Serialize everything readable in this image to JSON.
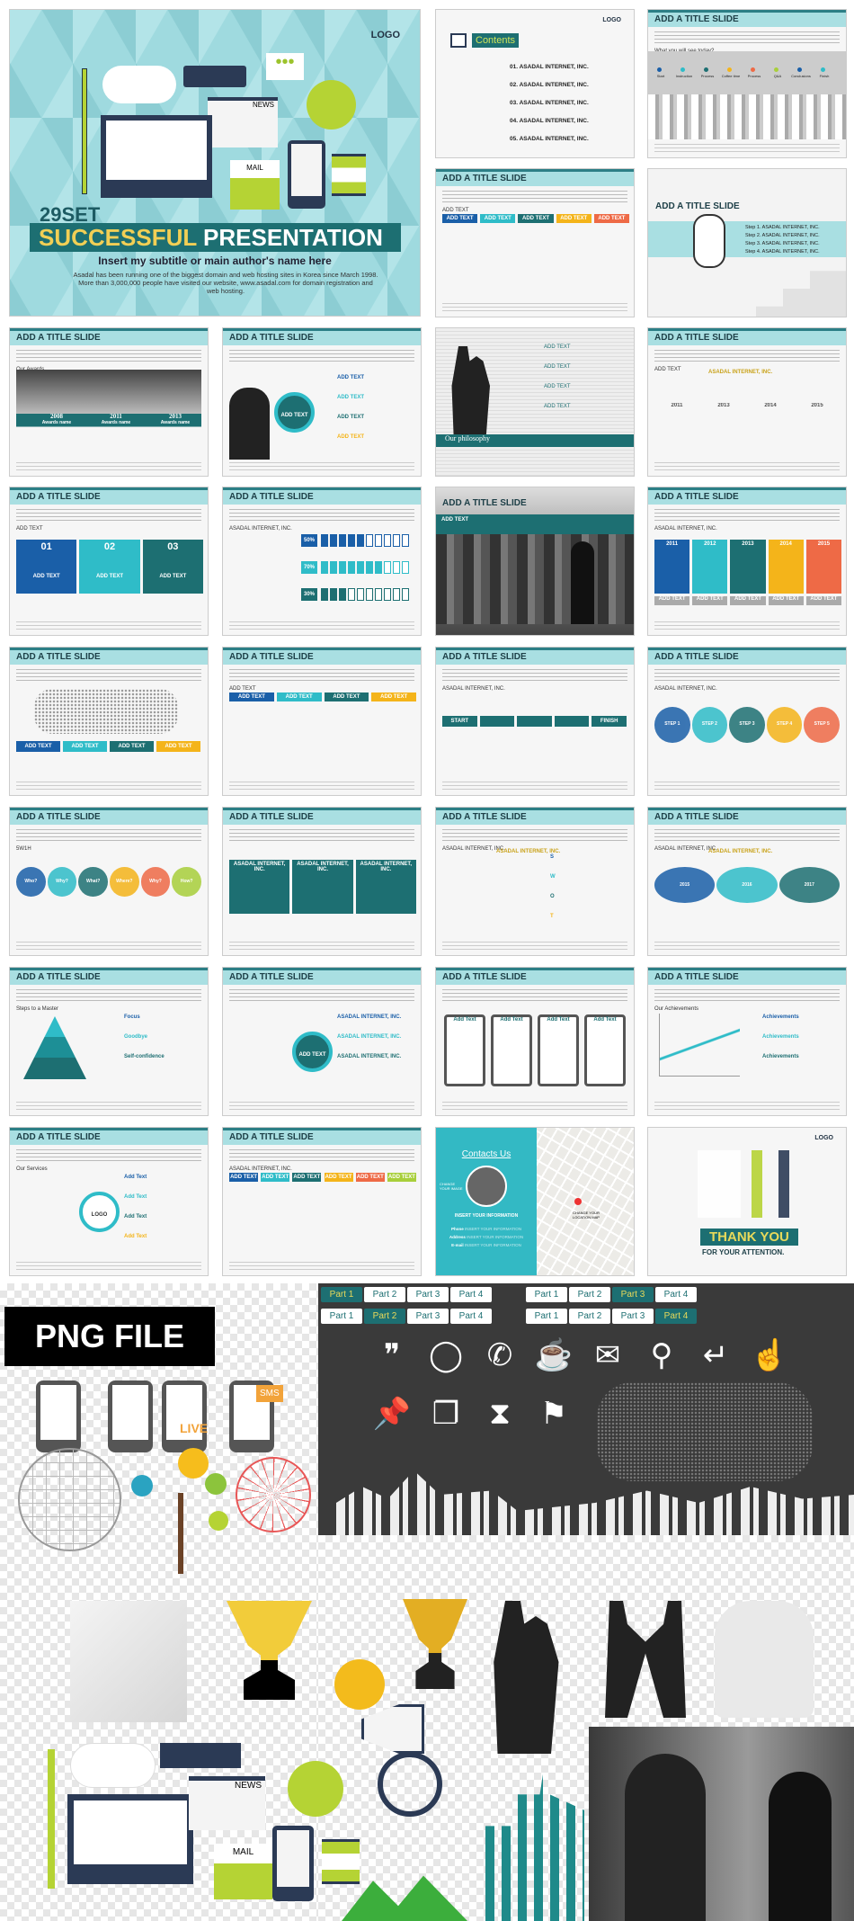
{
  "hero": {
    "logo": "LOGO",
    "set": "29SET",
    "title_accent": "SUCCESSFUL",
    "title_rest": "PRESENTATION",
    "subtitle": "Insert my subtitle or main author's name here",
    "description": "Asadal has been running one of the biggest domain and web hosting sites in Korea since March 1998. More than 3,000,000 people have visited our website, www.asadal.com for domain registration and web hosting.",
    "icons": [
      "pencil-icon",
      "cloud-icon",
      "usb-icon",
      "chat-bubble-icon",
      "news-icon",
      "lightbulb-icon",
      "monitor-icon",
      "mail-icon",
      "phone-icon",
      "hourglass-icon"
    ],
    "news": "NEWS",
    "mail": "MAIL"
  },
  "colors": {
    "teal_dark": "#1d6f72",
    "teal_light": "#a9dfe2",
    "cyan": "#2fbcc8",
    "blue": "#1a5fa8",
    "yellow": "#f4b41a",
    "orange": "#ee6a46",
    "green": "#a8cf3b"
  },
  "slides": [
    {
      "kind": "contents",
      "logo": "LOGO",
      "title": "Contents",
      "items": [
        "01. ASADAL INTERNET, INC.",
        "02. ASADAL INTERNET, INC.",
        "03. ASADAL INTERNET, INC.",
        "04. ASADAL INTERNET, INC.",
        "05. ASADAL INTERNET, INC."
      ]
    },
    {
      "kind": "timeline",
      "title": "ADD A TITLE SLIDE",
      "section": "What you will see today?",
      "items": [
        "Start",
        "Instruction",
        "Process",
        "Coffee time",
        "Process",
        "Q&A",
        "Conclusions",
        "Finish"
      ]
    },
    {
      "kind": "tabs",
      "title": "ADD A TITLE SLIDE",
      "section": "ADD TEXT",
      "items": [
        "ADD TEXT",
        "ADD TEXT",
        "ADD TEXT",
        "ADD TEXT",
        "ADD TEXT"
      ]
    },
    {
      "kind": "steps",
      "title": "ADD A TITLE SLIDE",
      "items": [
        "Step 1. ASADAL INTERNET, INC.",
        "Step 2. ASADAL INTERNET, INC.",
        "Step 3. ASADAL INTERNET, INC.",
        "Step 4. ASADAL INTERNET, INC."
      ]
    },
    {
      "kind": "awards",
      "title": "ADD A TITLE SLIDE",
      "section": "Our Awards",
      "items": [
        "2008",
        "2011",
        "2013"
      ],
      "sub": "Awards name"
    },
    {
      "kind": "circles",
      "title": "ADD A TITLE SLIDE",
      "center": "ADD TEXT",
      "items": [
        "ADD TEXT",
        "ADD TEXT",
        "ADD TEXT",
        "ADD TEXT"
      ]
    },
    {
      "kind": "philosophy",
      "title": "",
      "band": "Our philosophy",
      "items": [
        "ADD TEXT",
        "ADD TEXT",
        "ADD TEXT",
        "ADD TEXT"
      ]
    },
    {
      "kind": "years",
      "title": "ADD A TITLE SLIDE",
      "section": "ADD TEXT",
      "heading": "ASADAL INTERNET, INC.",
      "items": [
        "2011",
        "2013",
        "2014",
        "2015"
      ]
    },
    {
      "kind": "numbers",
      "title": "ADD A TITLE SLIDE",
      "section": "ADD TEXT",
      "items": [
        "01",
        "02",
        "03"
      ],
      "label": "ADD TEXT"
    },
    {
      "kind": "percent",
      "title": "ADD A TITLE SLIDE",
      "section": "ASADAL INTERNET, INC.",
      "items": [
        "50%",
        "70%",
        "30%"
      ],
      "levels": [
        50,
        70,
        30
      ]
    },
    {
      "kind": "city",
      "title": "ADD A TITLE SLIDE",
      "band": "ADD TEXT"
    },
    {
      "kind": "columns",
      "title": "ADD A TITLE SLIDE",
      "section": "ASADAL INTERNET, INC.",
      "items": [
        "2011",
        "2012",
        "2013",
        "2014",
        "2015"
      ],
      "label": "ADD TEXT"
    },
    {
      "kind": "worldmap",
      "title": "ADD A TITLE SLIDE",
      "items": [
        "ADD TEXT",
        "ADD TEXT",
        "ADD TEXT",
        "ADD TEXT"
      ]
    },
    {
      "kind": "tabs",
      "title": "ADD A TITLE SLIDE",
      "section": "ADD TEXT",
      "items": [
        "ADD TEXT",
        "ADD TEXT",
        "ADD TEXT",
        "ADD TEXT"
      ]
    },
    {
      "kind": "arrows",
      "title": "ADD A TITLE SLIDE",
      "section": "ASADAL INTERNET, INC.",
      "items": [
        "START",
        "",
        "",
        "",
        "FINISH"
      ]
    },
    {
      "kind": "steprings",
      "title": "ADD A TITLE SLIDE",
      "section": "ASADAL INTERNET, INC.",
      "items": [
        "STEP 1",
        "STEP 2",
        "STEP 3",
        "STEP 4",
        "STEP 5"
      ]
    },
    {
      "kind": "why",
      "title": "ADD A TITLE SLIDE",
      "section": "5W1H",
      "items": [
        "Who?",
        "Why?",
        "What?",
        "Where?",
        "Why?",
        "How?"
      ]
    },
    {
      "kind": "cards",
      "title": "ADD A TITLE SLIDE",
      "items": [
        "ASADAL INTERNET, INC.",
        "ASADAL INTERNET, INC.",
        "ASADAL INTERNET, INC."
      ]
    },
    {
      "kind": "swot",
      "title": "ADD A TITLE SLIDE",
      "section": "ASADAL INTERNET, INC.",
      "heading": "ASADAL INTERNET, INC.",
      "items": [
        "S",
        "W",
        "O",
        "T"
      ],
      "labels": [
        "ADD TEXT",
        "ADD TEXT",
        "ADD TEXT"
      ]
    },
    {
      "kind": "venn",
      "title": "ADD A TITLE SLIDE",
      "section": "ASADAL INTERNET, INC.",
      "heading": "ASADAL INTERNET, INC.",
      "items": [
        "2015",
        "2016",
        "2017"
      ]
    },
    {
      "kind": "pyramid",
      "title": "ADD A TITLE SLIDE",
      "section": "Steps to a Master",
      "items": [
        "Focus",
        "Goodbye",
        "Self-confidence"
      ]
    },
    {
      "kind": "hub",
      "title": "ADD A TITLE SLIDE",
      "center": "ADD TEXT",
      "items": [
        "ASADAL INTERNET, INC.",
        "ASADAL INTERNET, INC.",
        "ASADAL INTERNET, INC."
      ]
    },
    {
      "kind": "phones",
      "title": "ADD A TITLE SLIDE",
      "items": [
        "Add Text",
        "Add Text",
        "Add Text",
        "Add Text"
      ]
    },
    {
      "kind": "chart",
      "title": "ADD A TITLE SLIDE",
      "section": "Our Achievements",
      "items": [
        "Achievements",
        "Achievements",
        "Achievements"
      ]
    },
    {
      "kind": "services",
      "title": "ADD A TITLE SLIDE",
      "section": "Our Services",
      "center": "LOGO",
      "items": [
        "Add Text",
        "Add Text",
        "Add Text",
        "Add Text"
      ]
    },
    {
      "kind": "tabs",
      "title": "ADD A TITLE SLIDE",
      "section": "ASADAL INTERNET, INC.",
      "items": [
        "ADD TEXT",
        "ADD TEXT",
        "ADD TEXT",
        "ADD TEXT",
        "ADD TEXT",
        "ADD TEXT"
      ]
    },
    {
      "kind": "contact",
      "title": "Contacts Us",
      "info": "INSERT YOUR INFORMATION",
      "fields": [
        "Phone",
        "Address",
        "E-mail"
      ],
      "value": "INSERT YOUR INFORMATION",
      "image": "CHANGE YOUR IMAGE",
      "map": "CHANGE YOUR LOCATION MAP"
    },
    {
      "kind": "thanks",
      "logo": "LOGO",
      "title": "THANK YOU",
      "sub": "FOR YOUR ATTENTION."
    }
  ],
  "png": {
    "label": "PNG FILE",
    "tabs_row1": [
      [
        "Part 1",
        "Part 2",
        "Part 3",
        "Part 4"
      ],
      [
        "Part 1",
        "Part 2",
        "Part 3",
        "Part 4"
      ]
    ],
    "tabs_row2": [
      [
        "Part 1",
        "Part 2",
        "Part 3",
        "Part 4"
      ],
      [
        "Part 1",
        "Part 2",
        "Part 3",
        "Part 4"
      ]
    ],
    "active": [
      0,
      2,
      1,
      3
    ],
    "icons": [
      "quote-icon",
      "speech-bubble-icon",
      "phone-call-icon",
      "coffee-cup-icon",
      "envelope-icon",
      "location-pin-icon",
      "return-arrow-icon",
      "pointing-hand-icon",
      "pushpin-icon",
      "chat-bubbles-icon",
      "hourglass-icon",
      "flag-icon"
    ],
    "phone_labels": [
      "LIVE",
      "SMS"
    ],
    "news": "NEWS",
    "mail": "MAIL"
  }
}
